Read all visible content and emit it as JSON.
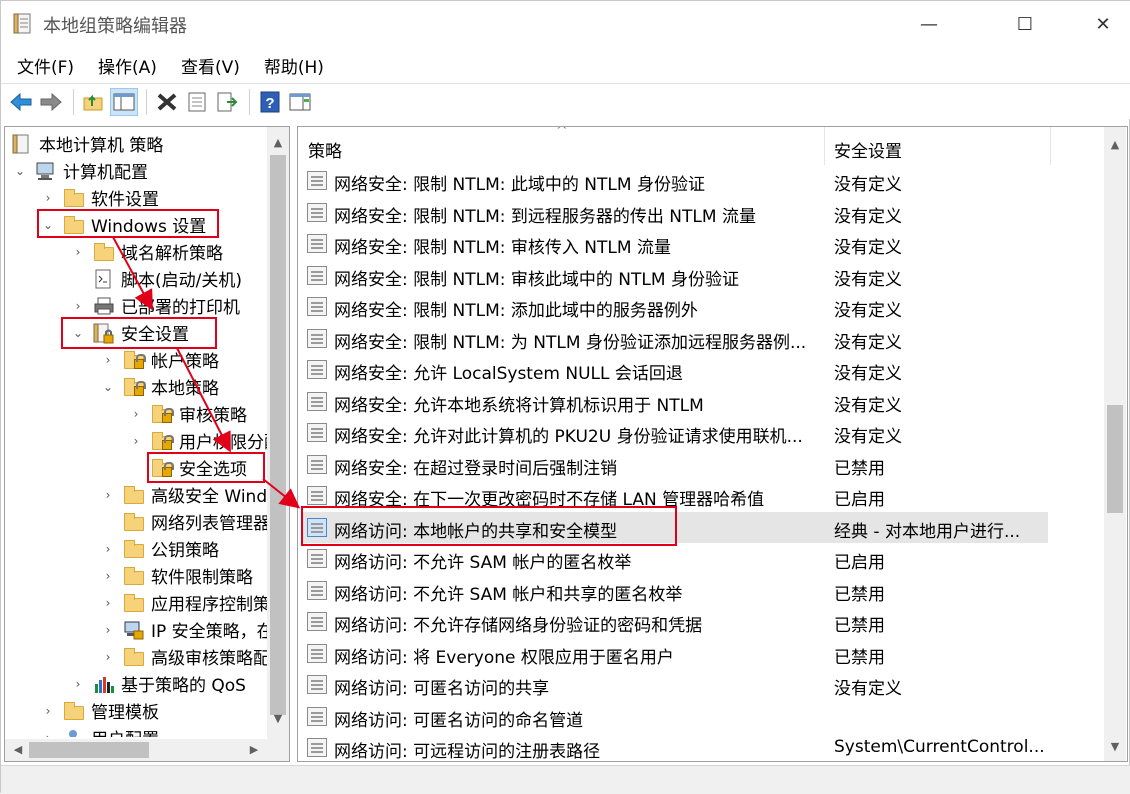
{
  "window": {
    "title": "本地组策略编辑器",
    "minimize": "—",
    "maximize": "☐",
    "close": "✕"
  },
  "menu": [
    "文件(F)",
    "操作(A)",
    "查看(V)",
    "帮助(H)"
  ],
  "tree": {
    "root": "本地计算机 策略",
    "computer_config": "计算机配置",
    "software_settings": "软件设置",
    "windows_settings": "Windows 设置",
    "dns_policy": "域名解析策略",
    "scripts": "脚本(启动/关机)",
    "printers": "已部署的打印机",
    "security_settings": "安全设置",
    "account_policy": "帐户策略",
    "local_policy": "本地策略",
    "audit_policy": "审核策略",
    "user_rights": "用户权限分配",
    "security_options": "安全选项",
    "adv_firewall": "高级安全 Windows Defender 防火墙",
    "network_list": "网络列表管理器策略",
    "public_key": "公钥策略",
    "software_restriction": "软件限制策略",
    "app_control": "应用程序控制策略",
    "ip_security": "IP 安全策略，在本地计算机",
    "adv_audit": "高级审核策略配置",
    "qos": "基于策略的 QoS",
    "admin_templates": "管理模板",
    "user_config": "用户配置"
  },
  "list": {
    "header": {
      "policy": "策略",
      "setting": "安全设置"
    },
    "rows": [
      {
        "policy": "网络安全: 限制 NTLM: 此域中的 NTLM 身份验证",
        "setting": "没有定义"
      },
      {
        "policy": "网络安全: 限制 NTLM: 到远程服务器的传出 NTLM 流量",
        "setting": "没有定义"
      },
      {
        "policy": "网络安全: 限制 NTLM: 审核传入 NTLM 流量",
        "setting": "没有定义"
      },
      {
        "policy": "网络安全: 限制 NTLM: 审核此域中的 NTLM 身份验证",
        "setting": "没有定义"
      },
      {
        "policy": "网络安全: 限制 NTLM: 添加此域中的服务器例外",
        "setting": "没有定义"
      },
      {
        "policy": "网络安全: 限制 NTLM: 为 NTLM 身份验证添加远程服务器例...",
        "setting": "没有定义"
      },
      {
        "policy": "网络安全: 允许 LocalSystem NULL 会话回退",
        "setting": "没有定义"
      },
      {
        "policy": "网络安全: 允许本地系统将计算机标识用于 NTLM",
        "setting": "没有定义"
      },
      {
        "policy": "网络安全: 允许对此计算机的 PKU2U 身份验证请求使用联机...",
        "setting": "没有定义"
      },
      {
        "policy": "网络安全: 在超过登录时间后强制注销",
        "setting": "已禁用"
      },
      {
        "policy": "网络安全: 在下一次更改密码时不存储 LAN 管理器哈希值",
        "setting": "已启用"
      },
      {
        "policy": "网络访问: 本地帐户的共享和安全模型",
        "setting": "经典 - 对本地用户进行..."
      },
      {
        "policy": "网络访问: 不允许 SAM 帐户的匿名枚举",
        "setting": "已启用"
      },
      {
        "policy": "网络访问: 不允许 SAM 帐户和共享的匿名枚举",
        "setting": "已禁用"
      },
      {
        "policy": "网络访问: 不允许存储网络身份验证的密码和凭据",
        "setting": "已禁用"
      },
      {
        "policy": "网络访问: 将 Everyone 权限应用于匿名用户",
        "setting": "已禁用"
      },
      {
        "policy": "网络访问: 可匿名访问的共享",
        "setting": "没有定义"
      },
      {
        "policy": "网络访问: 可匿名访问的命名管道",
        "setting": ""
      },
      {
        "policy": "网络访问: 可远程访问的注册表路径",
        "setting": "System\\CurrentControl..."
      }
    ]
  },
  "colors": {
    "highlight": "#e0001a",
    "selected_row": "#e5e5e5"
  }
}
